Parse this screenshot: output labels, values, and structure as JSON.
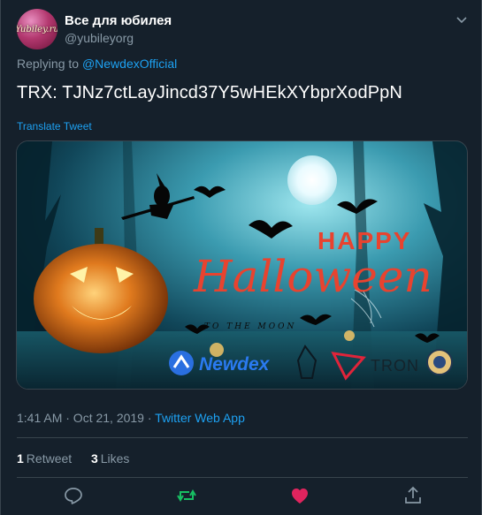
{
  "user": {
    "display_name": "Все для юбилея",
    "handle": "@yubileyorg",
    "avatar_text": "Yubiley.ru"
  },
  "reply": {
    "prefix": "Replying to ",
    "to": "@NewdexOfficial"
  },
  "tweet": {
    "text": "TRX: TJNz7ctLayJincd37Y5wHEkXYbprXodPpN",
    "translate_label": "Translate Tweet"
  },
  "media": {
    "happy": "HAPPY",
    "halloween": "Halloween",
    "to_the_moon": "TO THE MOON",
    "brand_newdex": "Newdex",
    "brand_tron": "TRON"
  },
  "meta": {
    "time_date": "1:41 AM · Oct 21, 2019 · ",
    "app": "Twitter Web App"
  },
  "stats": {
    "retweets_count": "1",
    "retweets_label": "Retweet",
    "likes_count": "3",
    "likes_label": "Likes"
  },
  "colors": {
    "background": "#15202b",
    "accent": "#1da1f2",
    "muted": "#8899a6",
    "retweet_green": "#17bf63",
    "like_pink": "#e0245e"
  },
  "icons": [
    "chevron-down-icon",
    "reply-icon",
    "retweet-icon",
    "like-icon",
    "share-icon"
  ]
}
